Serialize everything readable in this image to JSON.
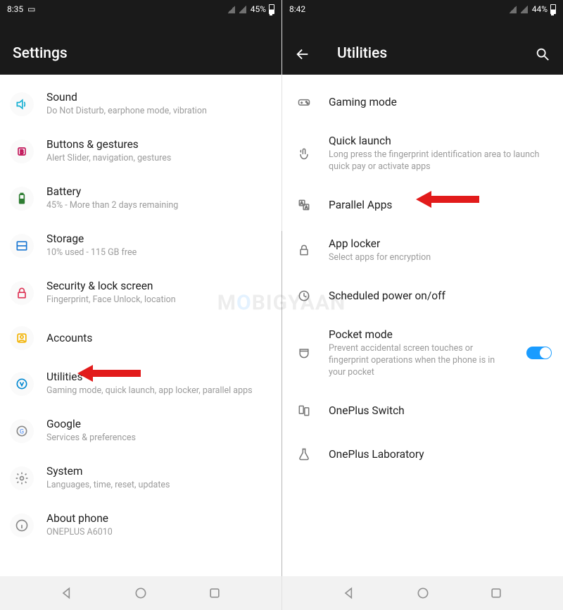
{
  "left": {
    "status": {
      "time": "8:35",
      "battery_pct": "45%"
    },
    "title": "Settings",
    "items": [
      {
        "icon": "speaker",
        "title": "Sound",
        "sub": "Do Not Disturb, earphone mode, vibration"
      },
      {
        "icon": "buttons",
        "title": "Buttons & gestures",
        "sub": "Alert Slider, navigation, gestures"
      },
      {
        "icon": "battery",
        "title": "Battery",
        "sub": "45% - More than 2 days remaining"
      },
      {
        "icon": "storage",
        "title": "Storage",
        "sub": "10% used - 115 GB free"
      },
      {
        "icon": "lock",
        "title": "Security & lock screen",
        "sub": "Fingerprint, Face Unlock, location"
      },
      {
        "icon": "accounts",
        "title": "Accounts",
        "sub": ""
      },
      {
        "icon": "utilities",
        "title": "Utilities",
        "sub": "Gaming mode, quick launch, app locker, parallel apps"
      },
      {
        "icon": "google",
        "title": "Google",
        "sub": "Services & preferences"
      },
      {
        "icon": "system",
        "title": "System",
        "sub": "Languages, time, reset, updates"
      },
      {
        "icon": "about",
        "title": "About phone",
        "sub": "ONEPLUS A6010"
      }
    ]
  },
  "right": {
    "status": {
      "time": "8:42",
      "battery_pct": "44%"
    },
    "title": "Utilities",
    "items": [
      {
        "icon": "gamepad",
        "title": "Gaming mode",
        "sub": ""
      },
      {
        "icon": "touch",
        "title": "Quick launch",
        "sub": "Long press the fingerprint identification area to launch quick pay or activate apps"
      },
      {
        "icon": "parallel",
        "title": "Parallel Apps",
        "sub": ""
      },
      {
        "icon": "padlock",
        "title": "App locker",
        "sub": "Select apps for encryption"
      },
      {
        "icon": "clock",
        "title": "Scheduled power on/off",
        "sub": ""
      },
      {
        "icon": "pocket",
        "title": "Pocket mode",
        "sub": "Prevent accidental screen touches or fingerprint operations when the phone is in your pocket",
        "switch": true
      },
      {
        "icon": "switch-phone",
        "title": "OnePlus Switch",
        "sub": ""
      },
      {
        "icon": "lab",
        "title": "OnePlus Laboratory",
        "sub": ""
      }
    ]
  },
  "watermark": "MOBIGYAAN",
  "arrow_targets": {
    "left_item_index": 6,
    "right_item_index": 2
  }
}
